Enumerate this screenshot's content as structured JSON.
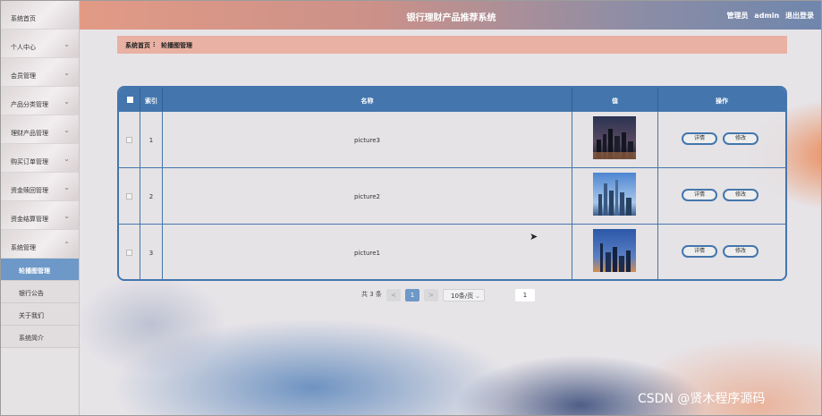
{
  "app": {
    "title": "银行理财产品推荐系统"
  },
  "header": {
    "user_role": "管理员",
    "username": "admin",
    "logout": "退出登录"
  },
  "sidebar": {
    "items": [
      {
        "label": "系统首页",
        "chevron": false
      },
      {
        "label": "个人中心",
        "chevron": true
      },
      {
        "label": "会员管理",
        "chevron": true
      },
      {
        "label": "产品分类管理",
        "chevron": true
      },
      {
        "label": "理财产品管理",
        "chevron": true
      },
      {
        "label": "购买订单管理",
        "chevron": true
      },
      {
        "label": "资金赎回管理",
        "chevron": true
      },
      {
        "label": "资金结算管理",
        "chevron": true
      },
      {
        "label": "系统管理",
        "chevron": true,
        "expanded": true
      }
    ],
    "subitems": [
      {
        "label": "轮播图管理",
        "active": true
      },
      {
        "label": "银行公告",
        "active": false
      },
      {
        "label": "关于我们",
        "active": false
      },
      {
        "label": "系统简介",
        "active": false
      }
    ]
  },
  "breadcrumb": {
    "home": "系统首页",
    "separator": "ⵗ",
    "current": "轮播图管理"
  },
  "table": {
    "headers": {
      "index": "索引",
      "name": "名称",
      "value": "值",
      "actions": "操作"
    },
    "rows": [
      {
        "index": "1",
        "name": "picture3",
        "thumb": "city-night"
      },
      {
        "index": "2",
        "name": "picture2",
        "thumb": "city-skyline-day"
      },
      {
        "index": "3",
        "name": "picture1",
        "thumb": "city-dusk"
      }
    ],
    "detail_label": "详情",
    "edit_label": "修改"
  },
  "pagination": {
    "total_text": "共 3 条",
    "prev": "<",
    "current_page": "1",
    "next": ">",
    "page_size": "10条/页",
    "jump_value": "1"
  },
  "watermark": "CSDN @贤木程序源码",
  "colors": {
    "primary": "#4476ad",
    "breadcrumb_bg": "#e9b1a3",
    "active_menu": "#6d98c8"
  }
}
